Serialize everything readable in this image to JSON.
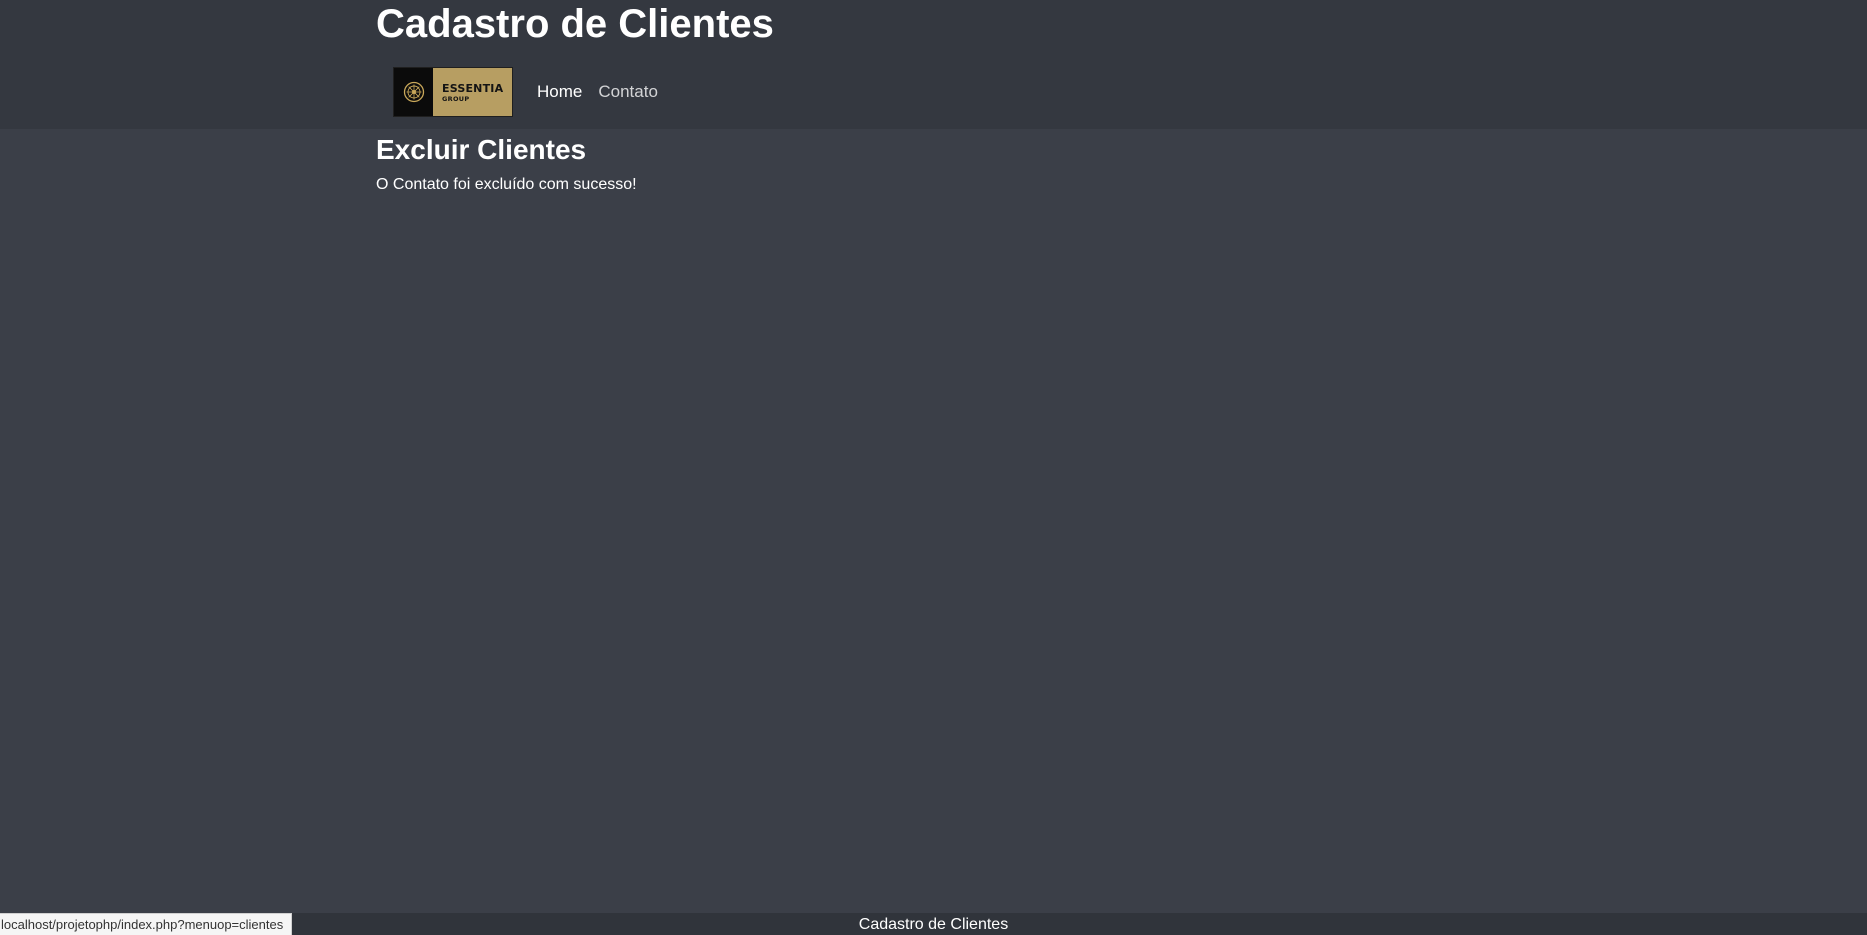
{
  "header": {
    "site_title": "Cadastro de Clientes",
    "brand": {
      "name": "ESSENTIA",
      "sub": "GROUP",
      "icon": "essentia-emblem-icon",
      "colors": {
        "emblem_bg": "#0b0b0b",
        "gold": "#b79e62"
      }
    },
    "nav": {
      "items": [
        {
          "label": "Home",
          "active": true
        },
        {
          "label": "Contato",
          "active": false
        }
      ]
    }
  },
  "main": {
    "heading": "Excluir Clientes",
    "message": "O Contato foi excluído com sucesso!"
  },
  "footer": {
    "text": "Cadastro de Clientes"
  },
  "browser_status": {
    "url": "localhost/projetophp/index.php?menuop=clientes"
  },
  "colors": {
    "header_bg": "#343840",
    "page_bg": "#3b3f48",
    "footer_bg": "#30343b"
  }
}
